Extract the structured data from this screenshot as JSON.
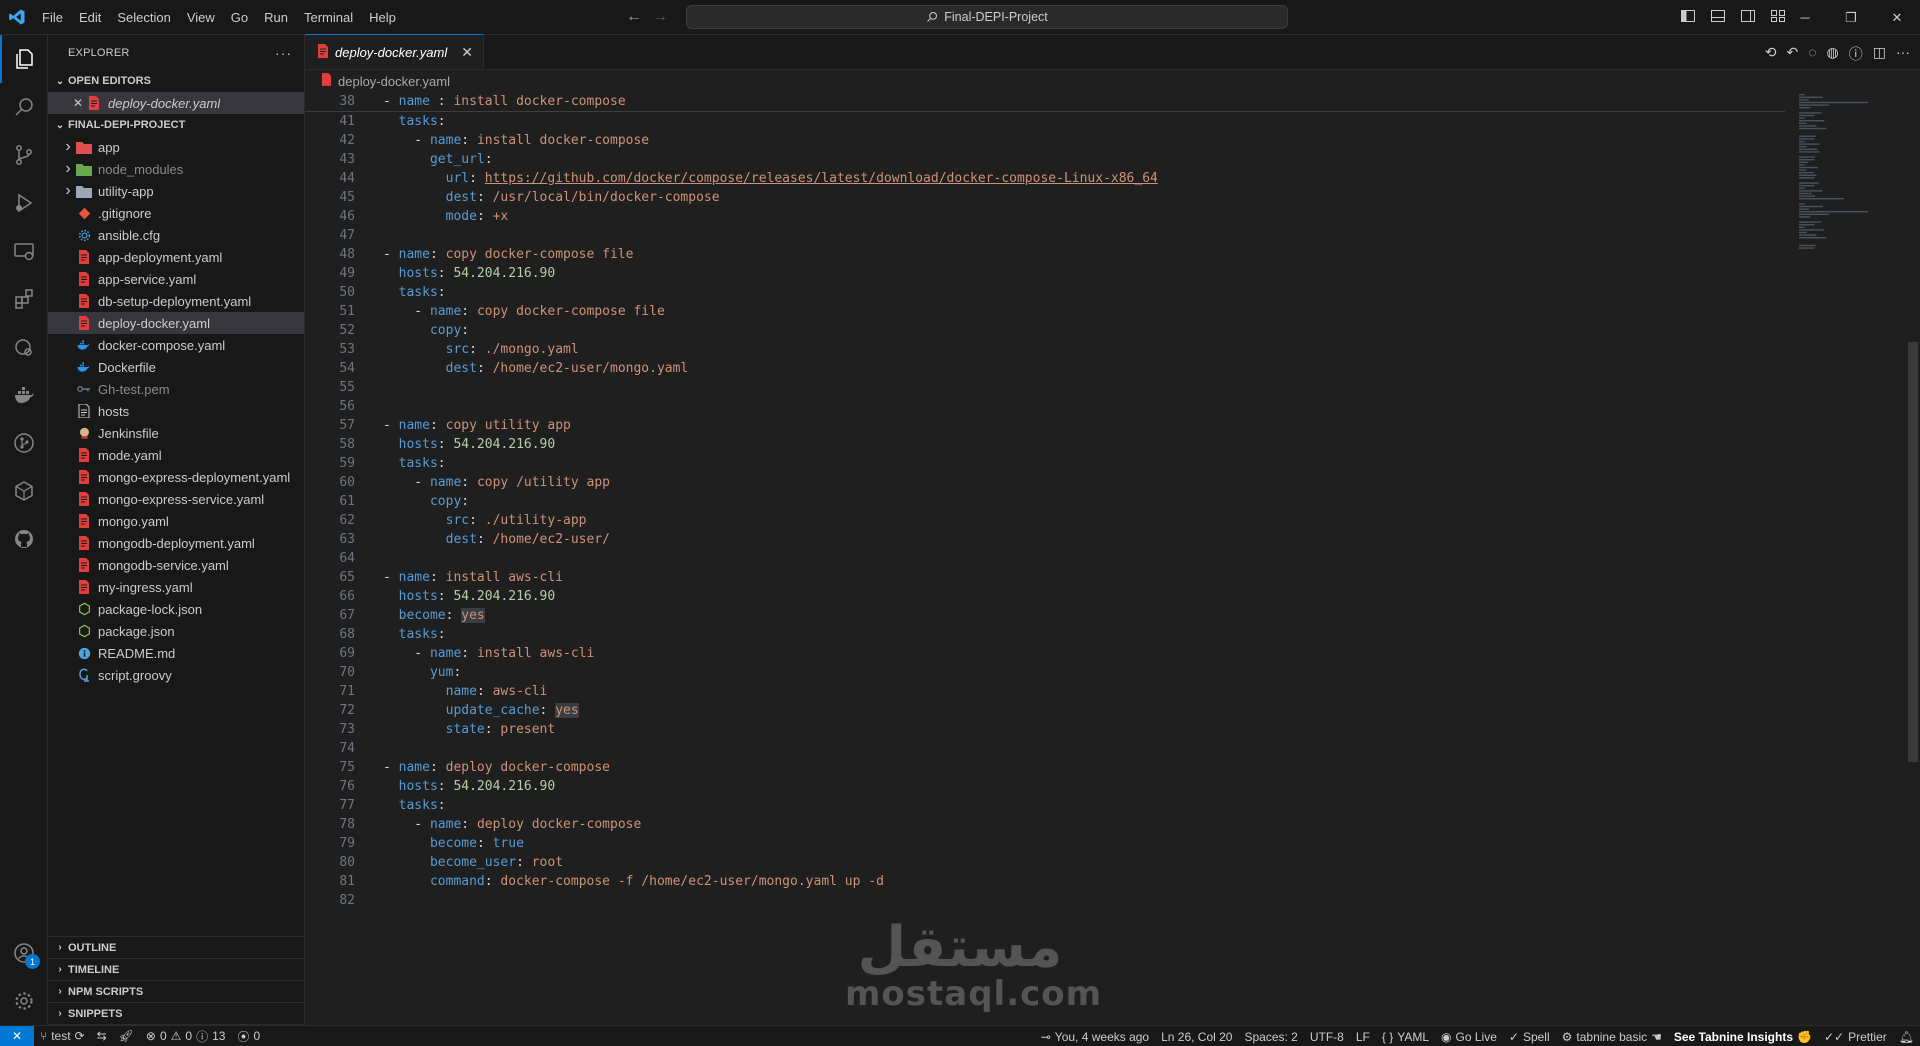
{
  "titlebar": {
    "menu": [
      "File",
      "Edit",
      "Selection",
      "View",
      "Go",
      "Run",
      "Terminal",
      "Help"
    ],
    "command_center": "Final-DEPI-Project"
  },
  "sidebar": {
    "title": "EXPLORER",
    "open_editors": {
      "title": "OPEN EDITORS",
      "items": [
        {
          "label": "deploy-docker.yaml"
        }
      ]
    },
    "project": {
      "title": "FINAL-DEPI-PROJECT",
      "items": [
        {
          "label": "app",
          "type": "folder",
          "icon": "folder-red-icon"
        },
        {
          "label": "node_modules",
          "type": "folder",
          "icon": "folder-green-icon"
        },
        {
          "label": "utility-app",
          "type": "folder",
          "icon": "folder-icon"
        },
        {
          "label": ".gitignore",
          "type": "file",
          "icon": "git-icon"
        },
        {
          "label": "ansible.cfg",
          "type": "file",
          "icon": "gear-file-icon"
        },
        {
          "label": "app-deployment.yaml",
          "type": "file",
          "icon": "yaml-icon"
        },
        {
          "label": "app-service.yaml",
          "type": "file",
          "icon": "yaml-icon"
        },
        {
          "label": "db-setup-deployment.yaml",
          "type": "file",
          "icon": "yaml-icon"
        },
        {
          "label": "deploy-docker.yaml",
          "type": "file",
          "icon": "yaml-icon"
        },
        {
          "label": "docker-compose.yaml",
          "type": "file",
          "icon": "docker-icon"
        },
        {
          "label": "Dockerfile",
          "type": "file",
          "icon": "docker-icon"
        },
        {
          "label": "Gh-test.pem",
          "type": "file",
          "icon": "key-icon"
        },
        {
          "label": "hosts",
          "type": "file",
          "icon": "file-icon"
        },
        {
          "label": "Jenkinsfile",
          "type": "file",
          "icon": "jenkins-icon"
        },
        {
          "label": "mode.yaml",
          "type": "file",
          "icon": "yaml-icon"
        },
        {
          "label": "mongo-express-deployment.yaml",
          "type": "file",
          "icon": "yaml-icon"
        },
        {
          "label": "mongo-express-service.yaml",
          "type": "file",
          "icon": "yaml-icon"
        },
        {
          "label": "mongo.yaml",
          "type": "file",
          "icon": "yaml-icon"
        },
        {
          "label": "mongodb-deployment.yaml",
          "type": "file",
          "icon": "yaml-icon"
        },
        {
          "label": "mongodb-service.yaml",
          "type": "file",
          "icon": "yaml-icon"
        },
        {
          "label": "my-ingress.yaml",
          "type": "file",
          "icon": "yaml-icon"
        },
        {
          "label": "package-lock.json",
          "type": "file",
          "icon": "nodejs-icon"
        },
        {
          "label": "package.json",
          "type": "file",
          "icon": "nodejs-icon"
        },
        {
          "label": "README.md",
          "type": "file",
          "icon": "info-icon"
        },
        {
          "label": "script.groovy",
          "type": "file",
          "icon": "groovy-icon"
        }
      ]
    },
    "bottom_sections": [
      "OUTLINE",
      "TIMELINE",
      "NPM SCRIPTS",
      "SNIPPETS"
    ]
  },
  "editor": {
    "tab_label": "deploy-docker.yaml",
    "breadcrumb": "deploy-docker.yaml",
    "sticky_line": {
      "num": "38",
      "text": "- name : install docker-compose"
    },
    "lines": [
      {
        "num": "41",
        "html": "  <span class='k'>tasks</span>:"
      },
      {
        "num": "42",
        "html": "    - <span class='k'>name</span>: <span class='s'>install docker-compose</span>"
      },
      {
        "num": "43",
        "html": "      <span class='k'>get_url</span>:"
      },
      {
        "num": "44",
        "html": "        <span class='k'>url</span>: <span class='u'>https://github.com/docker/compose/releases/latest/download/docker-compose-Linux-x86_64</span>"
      },
      {
        "num": "45",
        "html": "        <span class='k'>dest</span>: <span class='s'>/usr/local/bin/docker-compose</span>"
      },
      {
        "num": "46",
        "html": "        <span class='k'>mode</span>: <span class='s'>+x</span>"
      },
      {
        "num": "47",
        "html": ""
      },
      {
        "num": "48",
        "html": "- <span class='k'>name</span>: <span class='s'>copy docker-compose file</span>"
      },
      {
        "num": "49",
        "html": "  <span class='k'>hosts</span>: <span class='n'>54.204.216.90</span>"
      },
      {
        "num": "50",
        "html": "  <span class='k'>tasks</span>:"
      },
      {
        "num": "51",
        "html": "    - <span class='k'>name</span>: <span class='s'>copy docker-compose file</span>"
      },
      {
        "num": "52",
        "html": "      <span class='k'>copy</span>:"
      },
      {
        "num": "53",
        "html": "        <span class='k'>src</span>: <span class='s'>./mongo.yaml</span>"
      },
      {
        "num": "54",
        "html": "        <span class='k'>dest</span>: <span class='s'>/home/ec2-user/mongo.yaml</span>"
      },
      {
        "num": "55",
        "html": ""
      },
      {
        "num": "56",
        "html": ""
      },
      {
        "num": "57",
        "html": "- <span class='k'>name</span>: <span class='s'>copy utility app</span>"
      },
      {
        "num": "58",
        "html": "  <span class='k'>hosts</span>: <span class='n'>54.204.216.90</span>"
      },
      {
        "num": "59",
        "html": "  <span class='k'>tasks</span>:"
      },
      {
        "num": "60",
        "html": "    - <span class='k'>name</span>: <span class='s'>copy /utility app</span>"
      },
      {
        "num": "61",
        "html": "      <span class='k'>copy</span>:"
      },
      {
        "num": "62",
        "html": "        <span class='k'>src</span>: <span class='s'>./utility-app</span>"
      },
      {
        "num": "63",
        "html": "        <span class='k'>dest</span>: <span class='s'>/home/ec2-user/</span>"
      },
      {
        "num": "64",
        "html": ""
      },
      {
        "num": "65",
        "html": "- <span class='k'>name</span>: <span class='s'>install aws-cli</span>"
      },
      {
        "num": "66",
        "html": "  <span class='k'>hosts</span>: <span class='n'>54.204.216.90</span>"
      },
      {
        "num": "67",
        "html": "  <span class='k'>become</span>: <span class='hl'>yes</span>"
      },
      {
        "num": "68",
        "html": "  <span class='k'>tasks</span>:"
      },
      {
        "num": "69",
        "html": "    - <span class='k'>name</span>: <span class='s'>install aws-cli</span>"
      },
      {
        "num": "70",
        "html": "      <span class='k'>yum</span>:"
      },
      {
        "num": "71",
        "html": "        <span class='k'>name</span>: <span class='s'>aws-cli</span>"
      },
      {
        "num": "72",
        "html": "        <span class='k'>update_cache</span>: <span class='hl'>yes</span>"
      },
      {
        "num": "73",
        "html": "        <span class='k'>state</span>: <span class='s'>present</span>"
      },
      {
        "num": "74",
        "html": ""
      },
      {
        "num": "75",
        "html": "- <span class='k'>name</span>: <span class='s'>deploy docker-compose</span>"
      },
      {
        "num": "76",
        "html": "  <span class='k'>hosts</span>: <span class='n'>54.204.216.90</span>"
      },
      {
        "num": "77",
        "html": "  <span class='k'>tasks</span>:"
      },
      {
        "num": "78",
        "html": "    - <span class='k'>name</span>: <span class='s'>deploy docker-compose</span>"
      },
      {
        "num": "79",
        "html": "      <span class='k'>become</span>: <span class='k'>true</span>"
      },
      {
        "num": "80",
        "html": "      <span class='k'>become_user</span>: <span class='s'>root</span>"
      },
      {
        "num": "81",
        "html": "      <span class='k'>command</span>: <span class='s'>docker-compose -f /home/ec2-user/mongo.yaml up -d</span>"
      },
      {
        "num": "82",
        "html": ""
      }
    ]
  },
  "watermark": {
    "arabic": "مستقل",
    "latin": "mostaql.com"
  },
  "statusbar": {
    "branch": "test",
    "errors": "0",
    "warnings": "0",
    "info": "13",
    "ports": "0",
    "blame": "You, 4 weeks ago",
    "cursor": "Ln 26, Col 20",
    "spaces": "Spaces: 2",
    "encoding": "UTF-8",
    "eol": "LF",
    "language": "YAML",
    "golive": "Go Live",
    "spell": "Spell",
    "tabnine": "tabnine basic",
    "tabnine_insights": "See Tabnine Insights",
    "prettier": "Prettier"
  },
  "accounts_badge": "1",
  "colors": {
    "accent": "#0078d4",
    "keyword": "#569cd6",
    "string": "#ce9178",
    "number": "#b5cea8"
  }
}
